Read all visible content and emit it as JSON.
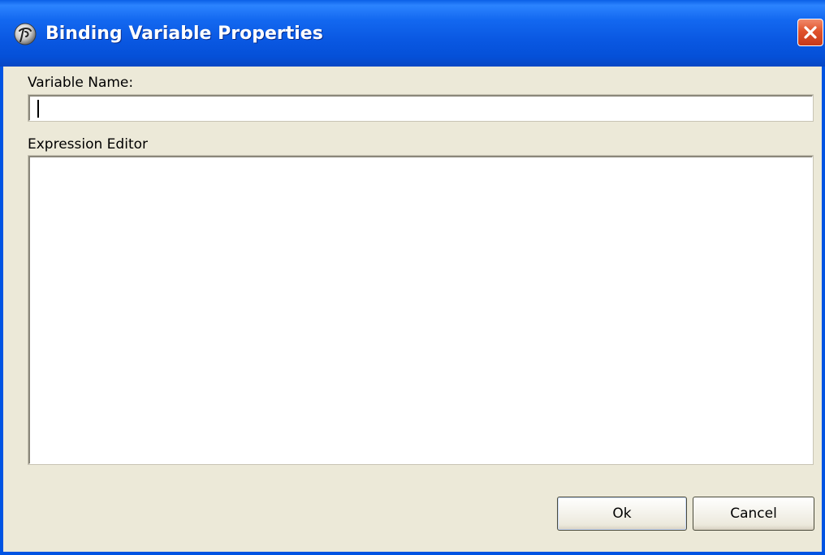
{
  "window": {
    "title": "Binding Variable Properties",
    "app_icon": "app-logo-icon",
    "close_icon": "close-icon"
  },
  "form": {
    "variable_name_label": "Variable Name:",
    "variable_name_value": "",
    "expression_editor_label": "Expression Editor",
    "expression_value": ""
  },
  "buttons": {
    "ok_label": "Ok",
    "cancel_label": "Cancel"
  },
  "colors": {
    "titlebar_blue": "#0054e3",
    "close_red": "#e0532c",
    "dialog_face": "#ece9d8"
  }
}
